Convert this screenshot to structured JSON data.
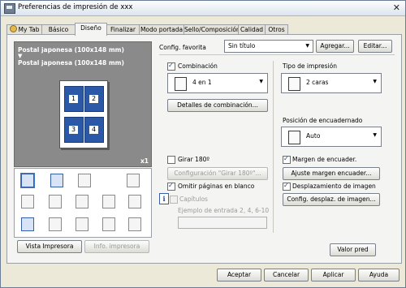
{
  "window": {
    "title": "Preferencias de impresión de xxx",
    "close_glyph": "✕"
  },
  "tabs": [
    "My Tab",
    "Básico",
    "Diseño",
    "Finalizar",
    "Modo portada",
    "Sello/Composición",
    "Calidad",
    "Otros"
  ],
  "active_tab": "Diseño",
  "preview": {
    "paper_line_1": "Postal japonesa (100x148 mm)",
    "arrow": "▼",
    "paper_line_2": "Postal japonesa (100x148 mm)",
    "copies": "x1",
    "page_numbers": [
      "1",
      "2",
      "3",
      "4"
    ]
  },
  "config": {
    "label": "Config. favorita",
    "value": "Sin título",
    "add_button": "Agregar...",
    "edit_button": "Editar..."
  },
  "combination": {
    "checkbox_label": "Combinación",
    "checked": true,
    "value": "4 en 1",
    "details_button": "Detalles de combinación..."
  },
  "print_type": {
    "label": "Tipo de impresión",
    "value": "2 caras"
  },
  "binding": {
    "label": "Posición de encuadernado",
    "value": "Auto"
  },
  "rotate": {
    "checkbox_label": "Girar 180º",
    "checked": false,
    "config_button": "Configuración \"Girar 180º\"..."
  },
  "skip_blank": {
    "checkbox_label": "Omitir páginas en blanco",
    "checked": true
  },
  "chapters": {
    "checkbox_label": "Capítulos",
    "checked": false,
    "example_label": "Ejemplo de entrada 2, 4, 6-10",
    "value": ""
  },
  "binding_margin": {
    "checkbox_label": "Margen de encuader.",
    "checked": true,
    "button": "Ajuste margen encuader..."
  },
  "image_shift": {
    "checkbox_label": "Desplazamiento de imagen",
    "checked": true,
    "button": "Config. desplaz. de imagen..."
  },
  "bottom_left": {
    "printer_view": "Vista Impresora",
    "printer_info": "Info. impresora"
  },
  "defaults_button": "Valor pred",
  "footer": {
    "ok": "Aceptar",
    "cancel": "Cancelar",
    "apply": "Aplicar",
    "help": "Ayuda"
  },
  "icon_names": [
    "layout-4in1-icon",
    "poster-icon",
    "image-icon",
    "rotate-icon",
    "pages-icon",
    "book-icon",
    "font-icon",
    "grid-icon",
    "stamp-icon",
    "doc-icon",
    "user-icon",
    "user-gear-icon",
    "table-icon",
    "lock-icon"
  ]
}
